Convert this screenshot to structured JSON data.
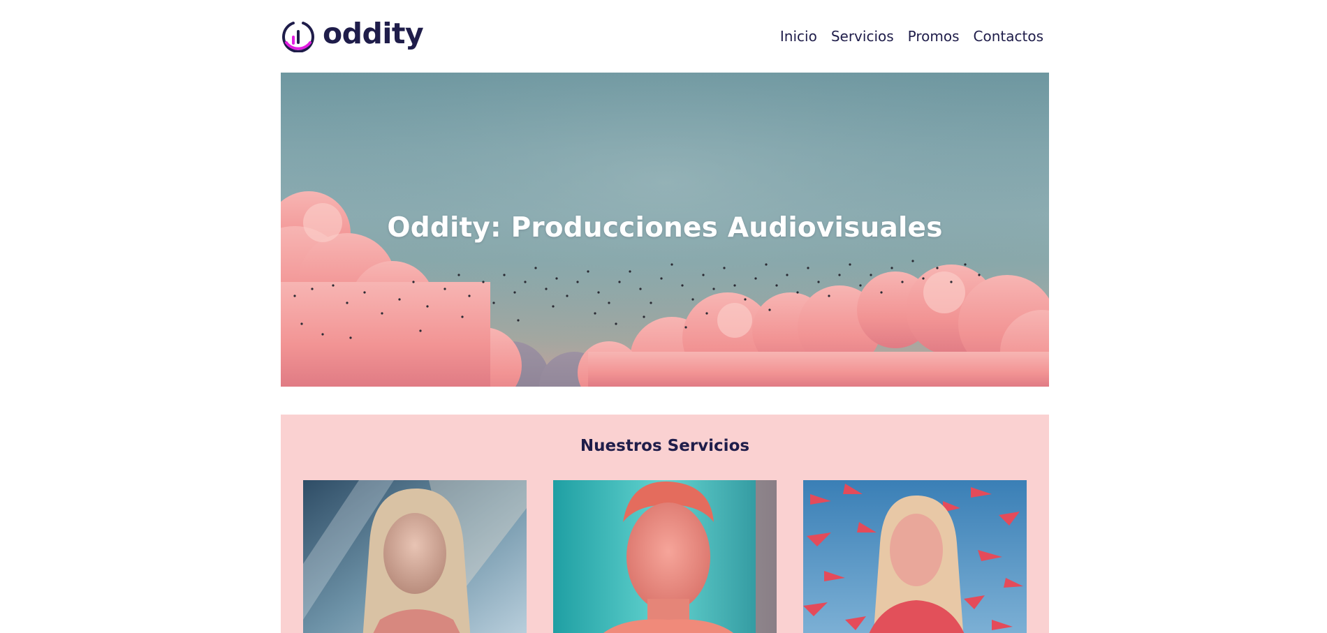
{
  "brand": {
    "name": "oddity",
    "logo_icon": "oddity-ring-logo-icon",
    "colors": {
      "navy": "#1f1d4a",
      "magenta": "#e21ee0",
      "services_bg": "#fad1d1"
    }
  },
  "nav": {
    "items": [
      {
        "label": "Inicio"
      },
      {
        "label": "Servicios"
      },
      {
        "label": "Promos"
      },
      {
        "label": "Contactos"
      }
    ]
  },
  "hero": {
    "title": "Oddity: Producciones Audiovisuales",
    "image": "pink-clouds-birds-sky-photo"
  },
  "services": {
    "title": "Nuestros Servicios",
    "cards": [
      {
        "image": "woman-portrait-light-rays-photo"
      },
      {
        "image": "man-portrait-teal-background-photo"
      },
      {
        "image": "woman-among-flying-birds-photo"
      }
    ]
  }
}
